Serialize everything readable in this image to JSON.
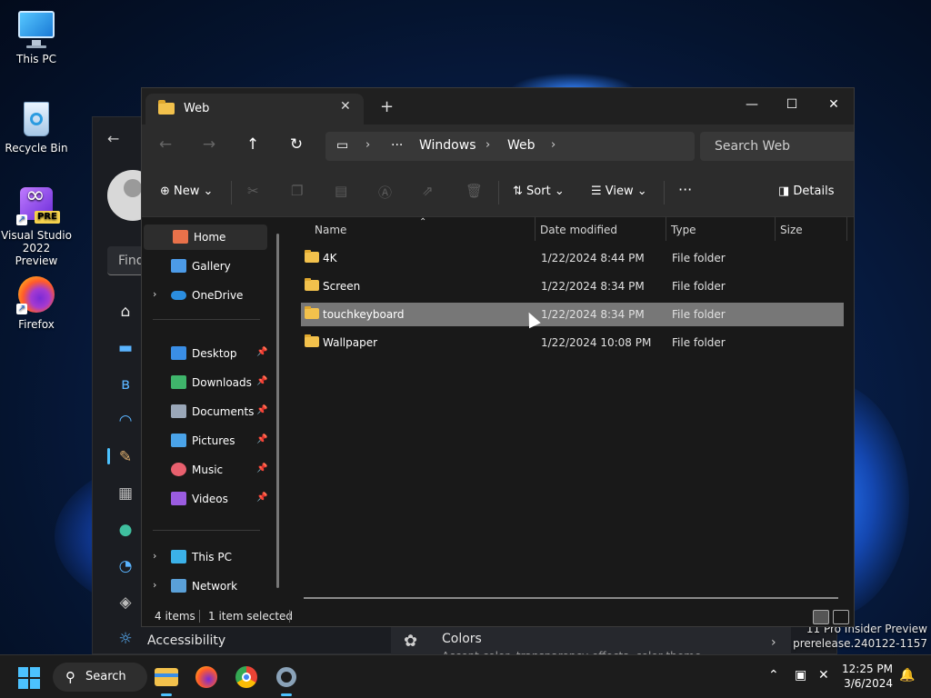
{
  "desktop": {
    "icons": [
      {
        "label": "This PC"
      },
      {
        "label": "Recycle Bin"
      },
      {
        "label": "Visual Studio 2022 Preview",
        "badge": "PRE"
      },
      {
        "label": "Firefox"
      }
    ],
    "watermark": {
      "line1": "11 Pro Insider Preview",
      "line2": "prerelease.240122-1157"
    }
  },
  "settings": {
    "search_placeholder": "Find",
    "accessibility_label": "Accessibility",
    "colors_title": "Colors",
    "colors_subtitle": "Accent color, transparency effects, color theme"
  },
  "explorer": {
    "tab_title": "Web",
    "new_tab": "+",
    "window_buttons": {
      "minimize": "—",
      "maximize": "☐",
      "close": "✕"
    },
    "address": {
      "more": "···",
      "crumbs": [
        "Windows",
        "Web"
      ]
    },
    "search_placeholder": "Search Web",
    "toolbar": {
      "new": "New",
      "sort": "Sort",
      "view": "View",
      "more": "···",
      "details": "Details"
    },
    "sidebar": {
      "home": "Home",
      "gallery": "Gallery",
      "onedrive": "OneDrive",
      "desktop": "Desktop",
      "downloads": "Downloads",
      "documents": "Documents",
      "pictures": "Pictures",
      "music": "Music",
      "videos": "Videos",
      "thispc": "This PC",
      "network": "Network"
    },
    "columns": {
      "name": "Name",
      "date": "Date modified",
      "type": "Type",
      "size": "Size"
    },
    "files": [
      {
        "name": "4K",
        "date": "1/22/2024 8:44 PM",
        "type": "File folder"
      },
      {
        "name": "Screen",
        "date": "1/22/2024 8:34 PM",
        "type": "File folder"
      },
      {
        "name": "touchkeyboard",
        "date": "1/22/2024 8:34 PM",
        "type": "File folder"
      },
      {
        "name": "Wallpaper",
        "date": "1/22/2024 10:08 PM",
        "type": "File folder"
      }
    ],
    "status": {
      "count": "4 items",
      "selected": "1 item selected"
    }
  },
  "taskbar": {
    "search_label": "Search",
    "clock_time": "12:25 PM",
    "clock_date": "3/6/2024"
  },
  "colors": {
    "accent": "#4cc2ff",
    "folder": "#f2c14c",
    "selection": "#777777"
  }
}
